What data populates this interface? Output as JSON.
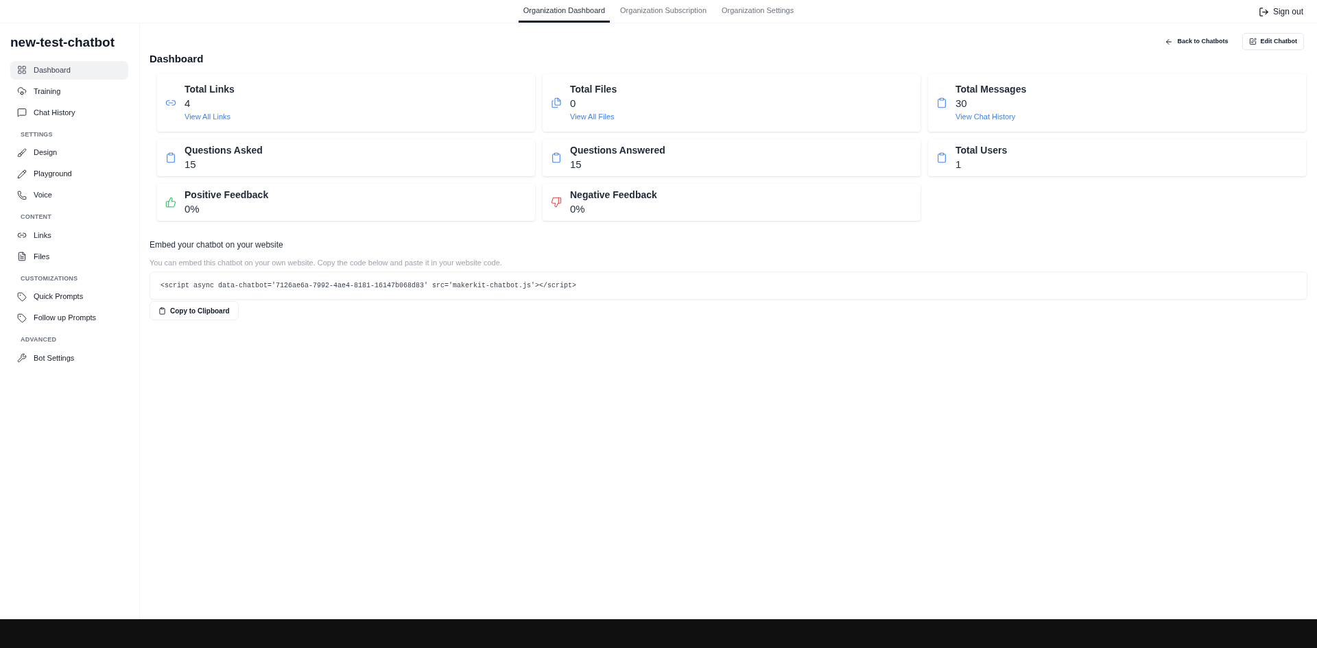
{
  "top_tabs": [
    {
      "label": "Organization Dashboard",
      "selected": true
    },
    {
      "label": "Organization Subscription",
      "selected": false
    },
    {
      "label": "Organization Settings",
      "selected": false
    }
  ],
  "sign_out": "Sign out",
  "chatbot_name": "new-test-chatbot",
  "header_actions": {
    "back": "Back to Chatbots",
    "edit": "Edit Chatbot"
  },
  "sidebar": {
    "sections": [
      {
        "items": [
          {
            "label": "Dashboard",
            "selected": true
          },
          {
            "label": "Training",
            "selected": false
          },
          {
            "label": "Chat History",
            "selected": false
          }
        ]
      },
      {
        "heading": "SETTINGS",
        "items": [
          {
            "label": "Design",
            "selected": false
          },
          {
            "label": "Playground",
            "selected": false
          },
          {
            "label": "Voice",
            "selected": false
          }
        ]
      },
      {
        "heading": "CONTENT",
        "items": [
          {
            "label": "Links",
            "selected": false
          },
          {
            "label": "Files",
            "selected": false
          }
        ]
      },
      {
        "heading": "CUSTOMIZATIONS",
        "items": [
          {
            "label": "Quick Prompts",
            "selected": false
          },
          {
            "label": "Follow up Prompts",
            "selected": false
          }
        ]
      },
      {
        "heading": "ADVANCED",
        "items": [
          {
            "label": "Bot Settings",
            "selected": false
          }
        ]
      }
    ]
  },
  "page_title": "Dashboard",
  "stats": [
    {
      "title": "Total Links",
      "value": "4",
      "link": "View All Links"
    },
    {
      "title": "Total Files",
      "value": "0",
      "link": "View All Files"
    },
    {
      "title": "Total Messages",
      "value": "30",
      "link": "View Chat History"
    },
    {
      "title": "Questions Asked",
      "value": "15"
    },
    {
      "title": "Questions Answered",
      "value": "15"
    },
    {
      "title": "Total Users",
      "value": "1"
    },
    {
      "title": "Positive Feedback",
      "value": "0%"
    },
    {
      "title": "Negative Feedback",
      "value": "0%"
    }
  ],
  "embed": {
    "heading": "Embed your chatbot on your website",
    "description": "You can embed this chatbot on your own website. Copy the code below and paste it in your website code.",
    "code": "<script async data-chatbot='7126ae6a-7992-4ae4-8181-16147b068d83' src='makerkit-chatbot.js'></script>",
    "copy_button": "Copy to Clipboard"
  }
}
